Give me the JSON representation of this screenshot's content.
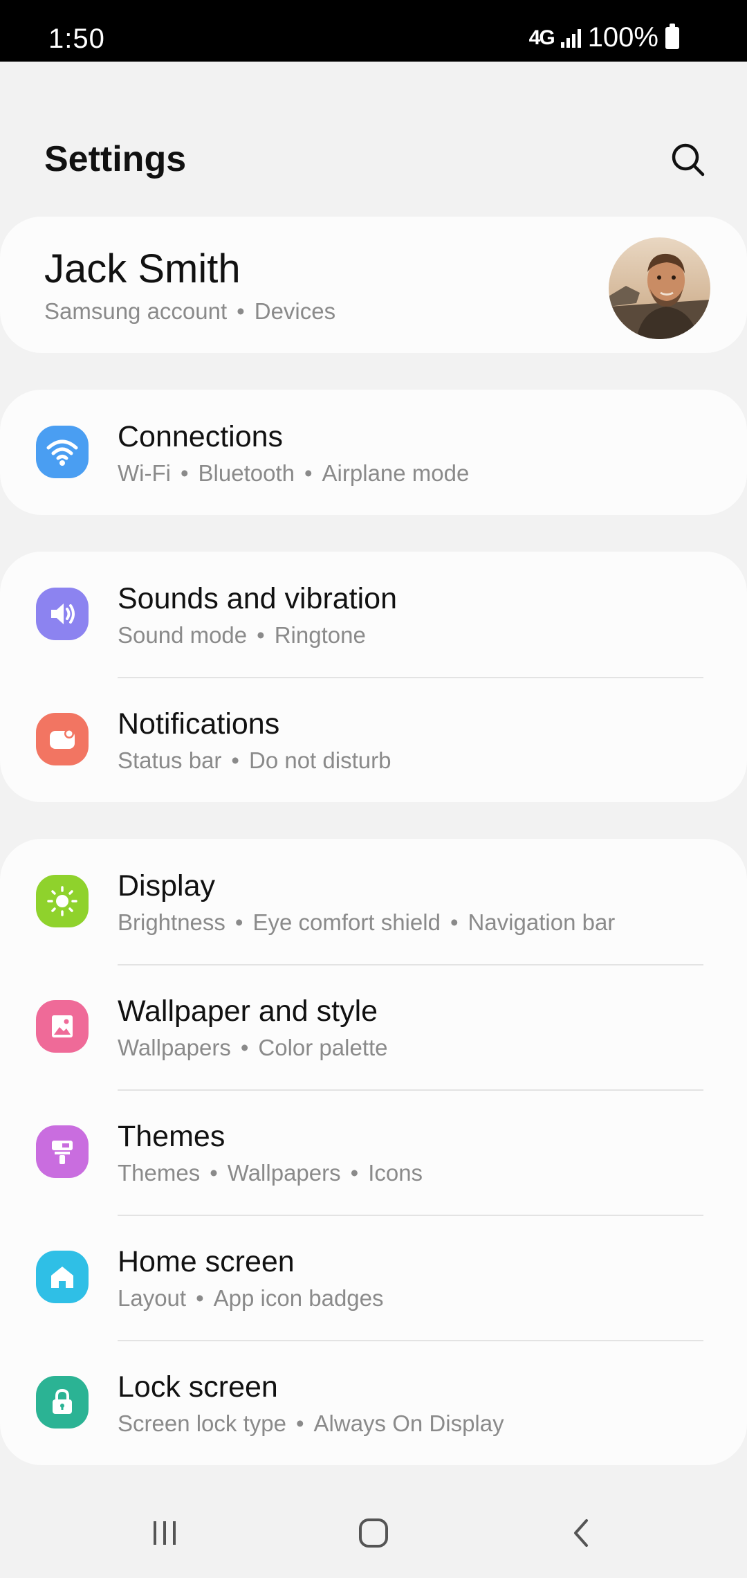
{
  "status_bar": {
    "time": "1:50",
    "network": "4G",
    "battery": "100%"
  },
  "header": {
    "title": "Settings",
    "search_icon": "search-icon"
  },
  "account": {
    "name": "Jack Smith",
    "links": [
      "Samsung account",
      "Devices"
    ]
  },
  "groups": [
    {
      "items": [
        {
          "title": "Connections",
          "subtitles": [
            "Wi-Fi",
            "Bluetooth",
            "Airplane mode"
          ],
          "icon": "wifi-icon",
          "color": "#4a9ef2"
        }
      ]
    },
    {
      "items": [
        {
          "title": "Sounds and vibration",
          "subtitles": [
            "Sound mode",
            "Ringtone"
          ],
          "icon": "speaker-icon",
          "color": "#8c83f0"
        },
        {
          "title": "Notifications",
          "subtitles": [
            "Status bar",
            "Do not disturb"
          ],
          "icon": "notification-icon",
          "color": "#f27562"
        }
      ]
    },
    {
      "items": [
        {
          "title": "Display",
          "subtitles": [
            "Brightness",
            "Eye comfort shield",
            "Navigation bar"
          ],
          "icon": "sun-icon",
          "color": "#8fd22c"
        },
        {
          "title": "Wallpaper and style",
          "subtitles": [
            "Wallpapers",
            "Color palette"
          ],
          "icon": "image-icon",
          "color": "#ef6a98"
        },
        {
          "title": "Themes",
          "subtitles": [
            "Themes",
            "Wallpapers",
            "Icons"
          ],
          "icon": "brush-icon",
          "color": "#c96ddf"
        },
        {
          "title": "Home screen",
          "subtitles": [
            "Layout",
            "App icon badges"
          ],
          "icon": "home-icon",
          "color": "#2fbfe6"
        },
        {
          "title": "Lock screen",
          "subtitles": [
            "Screen lock type",
            "Always On Display"
          ],
          "icon": "lock-icon",
          "color": "#2bb394"
        }
      ]
    }
  ],
  "nav_bar": {
    "buttons": [
      "recents-icon",
      "home-button-icon",
      "back-icon"
    ]
  }
}
